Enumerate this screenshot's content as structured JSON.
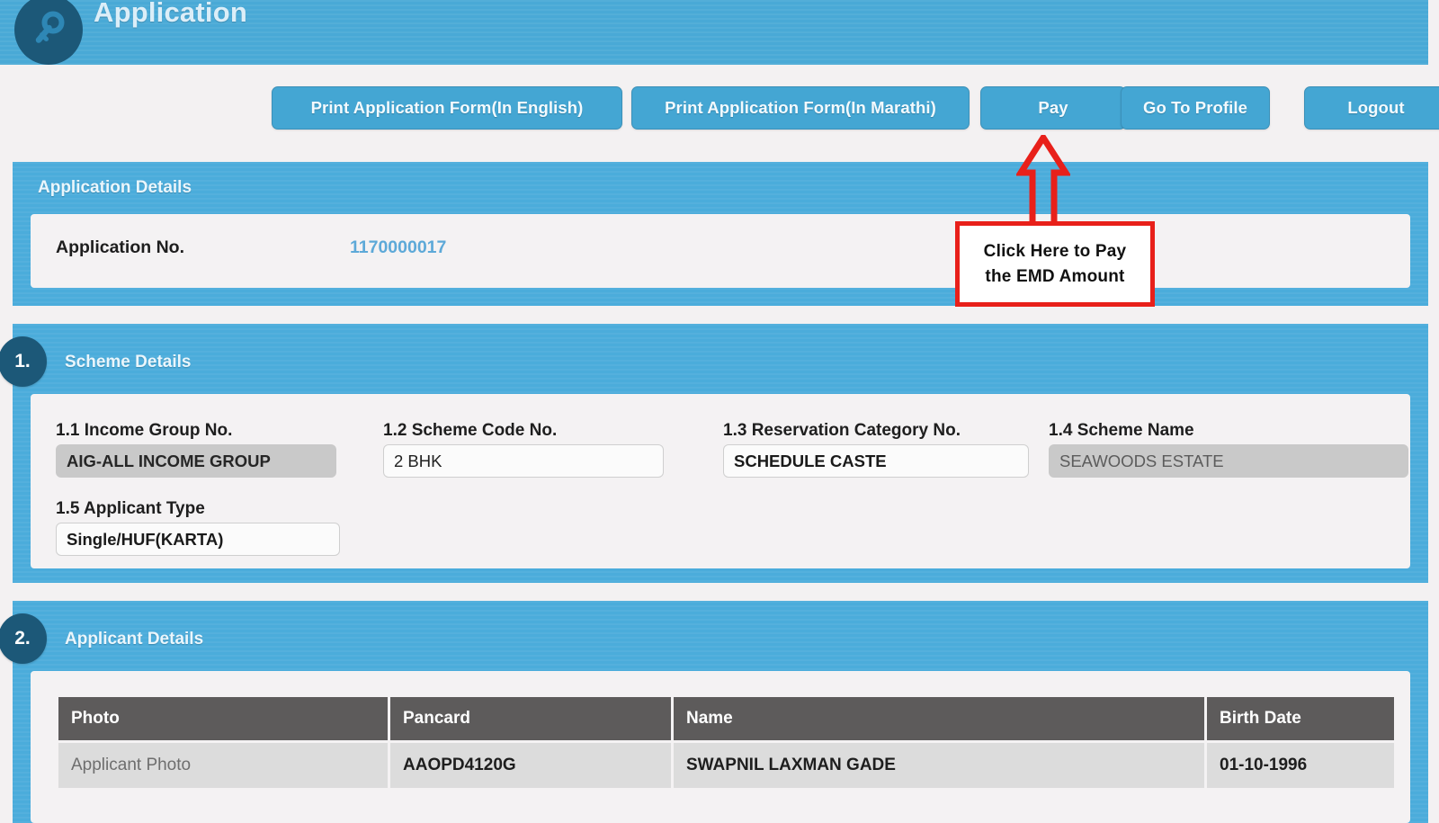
{
  "header": {
    "title": "Application",
    "icon": "key-icon"
  },
  "toolbar": {
    "print_english_label": "Print Application Form(In English)",
    "print_marathi_label": "Print Application Form(In Marathi)",
    "pay_label": "Pay",
    "profile_label": "Go To Profile",
    "logout_label": "Logout"
  },
  "application_details": {
    "section_title": "Application Details",
    "application_no_label": "Application No.",
    "application_no_value": "1170000017"
  },
  "scheme_details": {
    "number": "1.",
    "section_title": "Scheme Details",
    "fields": [
      {
        "label": "1.1 Income Group No.",
        "value": "AIG-ALL INCOME GROUP",
        "state": "disabled"
      },
      {
        "label": "1.2 Scheme Code No.",
        "value": "2 BHK",
        "state": "enabled"
      },
      {
        "label": "1.3 Reservation Category No.",
        "value": "SCHEDULE CASTE",
        "state": "enabled"
      },
      {
        "label": "1.4 Scheme Name",
        "value": "SEAWOODS ESTATE",
        "state": "disabled"
      },
      {
        "label": "1.5 Applicant Type",
        "value": "Single/HUF(KARTA)",
        "state": "enabled"
      }
    ]
  },
  "applicant_details": {
    "number": "2.",
    "section_title": "Applicant Details",
    "columns": [
      "Photo",
      "Pancard",
      "Name",
      "Birth Date"
    ],
    "rows": [
      {
        "photo": "Applicant Photo",
        "pancard": "AAOPD4120G",
        "name": "SWAPNIL  LAXMAN  GADE",
        "birth_date": "01-10-1996"
      }
    ]
  },
  "annotation": {
    "line1": "Click Here to Pay",
    "line2": "the EMD Amount",
    "arrow": "up-arrow-annotation",
    "color": "#E8201A"
  },
  "colors": {
    "panel_blue": "#4BACDB",
    "header_blue": "#49A9D6",
    "badge_dark": "#1C5878",
    "table_header": "#5D5B5B",
    "table_row": "#DCDCDC",
    "page_bg": "#F3F1F2",
    "link_blue": "#5DA9D8"
  }
}
